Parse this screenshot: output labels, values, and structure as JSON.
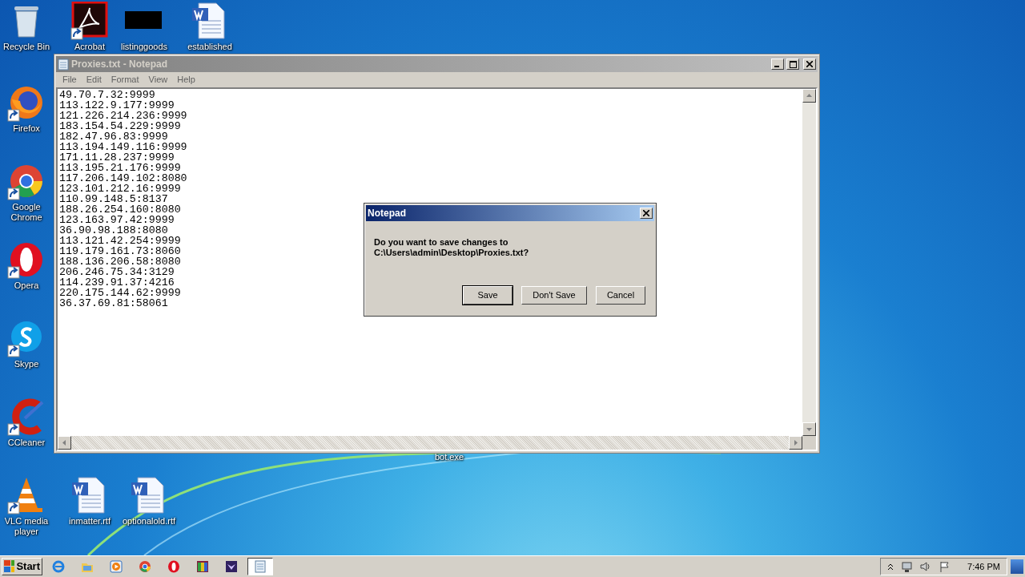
{
  "desktop_icons": [
    {
      "label": "Recycle Bin",
      "kind": "recycle",
      "shortcut": false
    },
    {
      "label": "Acrobat",
      "kind": "pdf",
      "shortcut": true
    },
    {
      "label": "listinggoods",
      "kind": "black",
      "shortcut": false
    },
    {
      "label": "established",
      "kind": "word",
      "shortcut": false
    },
    {
      "label": "Firefox",
      "kind": "firefox",
      "shortcut": true
    },
    {
      "label": "Google Chrome",
      "kind": "chrome",
      "shortcut": true
    },
    {
      "label": "Opera",
      "kind": "opera",
      "shortcut": true
    },
    {
      "label": "Skype",
      "kind": "skype",
      "shortcut": true
    },
    {
      "label": "CCleaner",
      "kind": "ccleaner",
      "shortcut": true
    },
    {
      "label": "bot.exe",
      "kind": "hidden"
    },
    {
      "label": "VLC media player",
      "kind": "vlc",
      "shortcut": true
    },
    {
      "label": "inmatter.rtf",
      "kind": "word",
      "shortcut": false
    },
    {
      "label": "optionalold.rtf",
      "kind": "word",
      "shortcut": false
    }
  ],
  "notepad": {
    "title": "Proxies.txt - Notepad",
    "active": false,
    "menu": [
      "File",
      "Edit",
      "Format",
      "View",
      "Help"
    ],
    "lines": [
      "49.70.7.32:9999",
      "113.122.9.177:9999",
      "121.226.214.236:9999",
      "183.154.54.229:9999",
      "182.47.96.83:9999",
      "113.194.149.116:9999",
      "171.11.28.237:9999",
      "113.195.21.176:9999",
      "117.206.149.102:8080",
      "123.101.212.16:9999",
      "110.99.148.5:8137",
      "188.26.254.160:8080",
      "123.163.97.42:9999",
      "36.90.98.188:8080",
      "113.121.42.254:9999",
      "119.179.161.73:8060",
      "188.136.206.58:8080",
      "206.246.75.34:3129",
      "114.239.91.37:4216",
      "220.175.144.62:9999",
      "36.37.69.81:58061"
    ]
  },
  "dialog": {
    "title": "Notepad",
    "active": true,
    "message": [
      "Do you want to save changes to",
      "C:\\Users\\admin\\Desktop\\Proxies.txt?"
    ],
    "buttons": [
      {
        "label": "Save",
        "default": true
      },
      {
        "label": "Don't Save",
        "default": false
      },
      {
        "label": "Cancel",
        "default": false
      }
    ]
  },
  "taskbar": {
    "start": "Start",
    "items": [
      {
        "kind": "ie",
        "pressed": false
      },
      {
        "kind": "folder",
        "pressed": false
      },
      {
        "kind": "media",
        "pressed": false
      },
      {
        "kind": "chrome",
        "pressed": false
      },
      {
        "kind": "opera",
        "pressed": false
      },
      {
        "kind": "winrar",
        "pressed": false
      },
      {
        "kind": "purple",
        "pressed": false
      },
      {
        "kind": "notepad",
        "pressed": true
      }
    ],
    "clock": "7:46 PM"
  }
}
